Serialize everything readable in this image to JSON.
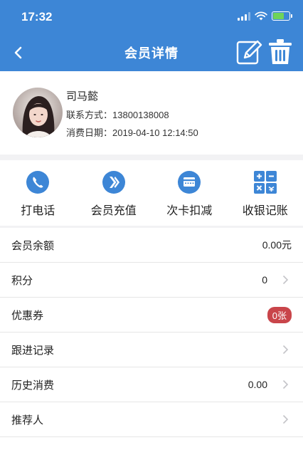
{
  "status": {
    "time": "17:32"
  },
  "nav": {
    "title": "会员详情"
  },
  "member": {
    "name": "司马懿",
    "contact_label": "联系方式：",
    "contact": "13800138008",
    "date_label": "消费日期：",
    "date": "2019-04-10 12:14:50"
  },
  "actions": [
    {
      "label": "打电话",
      "icon": "phone-icon"
    },
    {
      "label": "会员充值",
      "icon": "recharge-icon"
    },
    {
      "label": "次卡扣减",
      "icon": "card-deduct-icon"
    },
    {
      "label": "收银记账",
      "icon": "calculator-icon"
    }
  ],
  "rows": {
    "balance": {
      "label": "会员余额",
      "value": "0.00元"
    },
    "points": {
      "label": "积分",
      "value": "0"
    },
    "coupons": {
      "label": "优惠券",
      "value": "0张"
    },
    "followup": {
      "label": "跟进记录"
    },
    "history": {
      "label": "历史消费",
      "value": "0.00"
    },
    "referrer": {
      "label": "推荐人"
    }
  },
  "colors": {
    "primary": "#3d86d6",
    "badge": "#c9454a",
    "battery": "#6fd35a"
  }
}
